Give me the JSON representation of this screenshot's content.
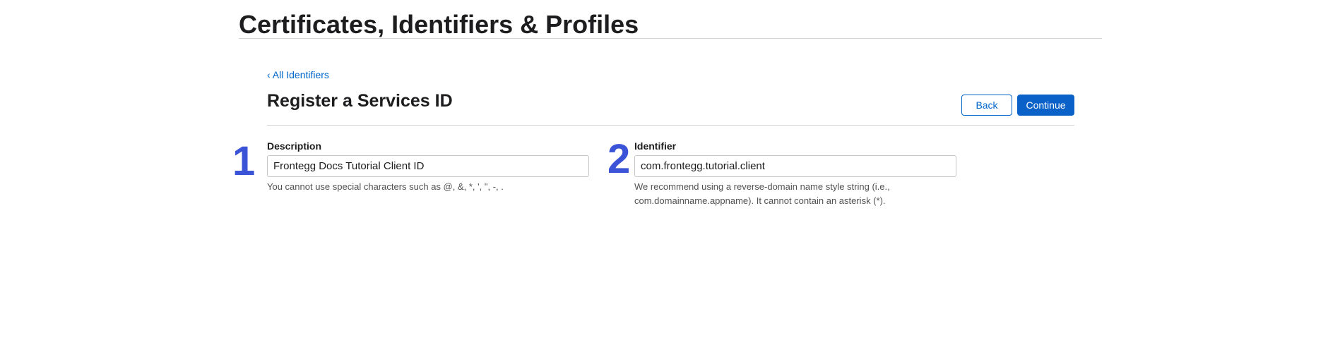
{
  "header": {
    "title": "Certificates, Identifiers & Profiles"
  },
  "nav": {
    "back_link": "‹ All Identifiers"
  },
  "section": {
    "title": "Register a Services ID",
    "back_button": "Back",
    "continue_button": "Continue"
  },
  "fields": {
    "description": {
      "step": "1",
      "label": "Description",
      "value": "Frontegg Docs Tutorial Client ID",
      "help": "You cannot use special characters such as @, &, *, ', \", -, ."
    },
    "identifier": {
      "step": "2",
      "label": "Identifier",
      "value": "com.frontegg.tutorial.client",
      "help": "We recommend using a reverse-domain name style string (i.e., com.domainname.appname). It cannot contain an asterisk (*)."
    }
  },
  "colors": {
    "accent": "#0066cc",
    "primary_button": "#0a62c9",
    "step_marker": "#3b53d6"
  }
}
